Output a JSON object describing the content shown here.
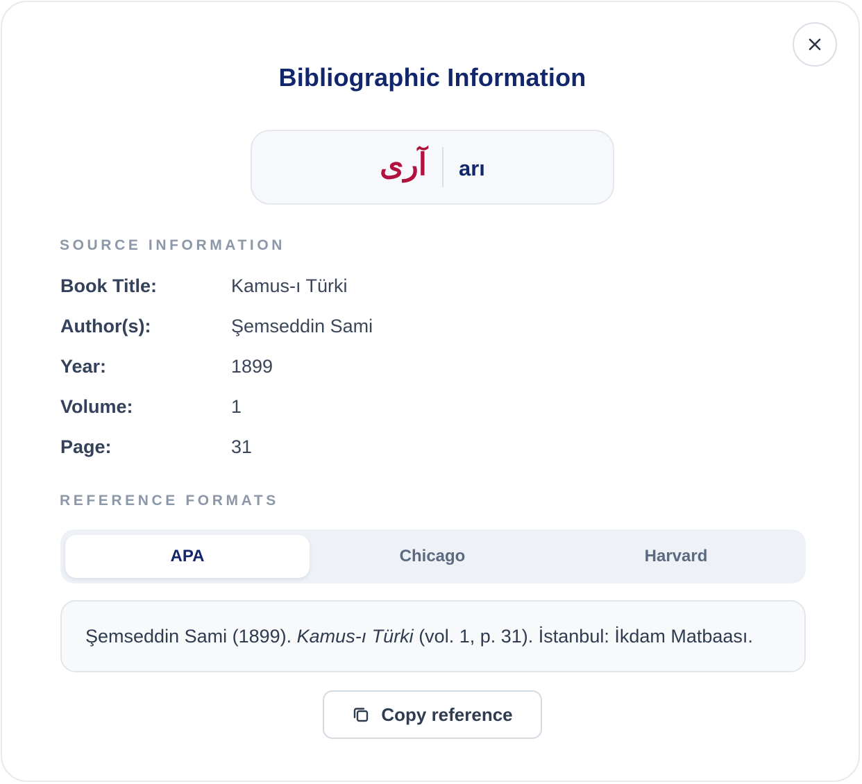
{
  "dialog": {
    "title": "Bibliographic Information",
    "close_icon": "close-icon"
  },
  "entry": {
    "arabic": "آری",
    "latin": "arı"
  },
  "source": {
    "section_label": "SOURCE INFORMATION",
    "rows": [
      {
        "key": "Book Title:",
        "value": "Kamus-ı Türki"
      },
      {
        "key": "Author(s):",
        "value": "Şemseddin Sami"
      },
      {
        "key": "Year:",
        "value": "1899"
      },
      {
        "key": "Volume:",
        "value": "1"
      },
      {
        "key": "Page:",
        "value": "31"
      }
    ]
  },
  "formats": {
    "section_label": "REFERENCE FORMATS",
    "tabs": [
      {
        "label": "APA",
        "active": true
      },
      {
        "label": "Chicago",
        "active": false
      },
      {
        "label": "Harvard",
        "active": false
      }
    ],
    "citation": {
      "prefix": "Şemseddin Sami (1899). ",
      "title": "Kamus-ı Türki",
      "suffix": " (vol. 1, p. 31). İstanbul: İkdam Matbaası."
    }
  },
  "actions": {
    "copy_label": "Copy reference",
    "copy_icon": "copy-icon"
  },
  "colors": {
    "title": "#12276b",
    "arabic_accent": "#b1123f",
    "muted_label": "#8c97a8"
  }
}
